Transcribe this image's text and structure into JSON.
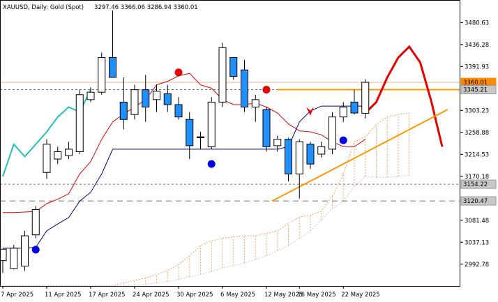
{
  "chart_data": {
    "type": "candlestick",
    "title": "XAUUSD, Daily:  Gold (Spot)",
    "ohlc_label": "3297.46 3366.06 3286.94 3360.01",
    "colors": {
      "background": "#ffffff",
      "bull_candle": "#ffffff",
      "bear_candle": "#1e90ff",
      "candle_outline": "#000000",
      "red_line": "#e60000",
      "blue_line": "#00008b",
      "teal_line": "#20c0c0",
      "trend_line": "#ff9900",
      "kumo": "#f4a460",
      "current_price": "#ff8c00",
      "marker_red": "#e60000",
      "marker_blue": "#0000e6"
    },
    "y_axis": {
      "min": 2948.78,
      "max": 3524.78,
      "ticks": [
        "3480.63",
        "3436.28",
        "3391.93",
        "3303.23",
        "3258.88",
        "3214.53",
        "3170.18",
        "3081.48",
        "3037.13",
        "2992.78"
      ],
      "price_labels": [
        {
          "value": 3360.01,
          "text": "3360.01",
          "kind": "current"
        },
        {
          "value": 3345.21,
          "text": "3345.21",
          "kind": "level"
        },
        {
          "value": 3154.22,
          "text": "3154.22",
          "kind": "level"
        },
        {
          "value": 3120.47,
          "text": "3120.47",
          "kind": "level"
        }
      ]
    },
    "x_axis": {
      "ticks": [
        {
          "index": 0,
          "label": "7 Apr 2025"
        },
        {
          "index": 4,
          "label": "11 Apr 2025"
        },
        {
          "index": 8,
          "label": "17 Apr 2025"
        },
        {
          "index": 12,
          "label": "24 Apr 2025"
        },
        {
          "index": 16,
          "label": "30 Apr 2025"
        },
        {
          "index": 20,
          "label": "6 May 2025"
        },
        {
          "index": 24,
          "label": "12 May 2025"
        },
        {
          "index": 27,
          "label": "16 May 2025"
        },
        {
          "index": 31,
          "label": "22 May 2025"
        }
      ]
    },
    "candles": [
      {
        "o": 3000,
        "h": 3005,
        "l": 2975,
        "c": 3023
      },
      {
        "o": 2984,
        "h": 3032,
        "l": 2982,
        "c": 3025
      },
      {
        "o": 2989,
        "h": 3060,
        "l": 2979,
        "c": 3050
      },
      {
        "o": 3052,
        "h": 3110,
        "l": 3045,
        "c": 3103
      },
      {
        "o": 3178,
        "h": 3245,
        "l": 3165,
        "c": 3235
      },
      {
        "o": 3205,
        "h": 3230,
        "l": 3195,
        "c": 3220
      },
      {
        "o": 3212,
        "h": 3240,
        "l": 3205,
        "c": 3225
      },
      {
        "o": 3220,
        "h": 3345,
        "l": 3215,
        "c": 3335
      },
      {
        "o": 3325,
        "h": 3350,
        "l": 3320,
        "c": 3340
      },
      {
        "o": 3340,
        "h": 3420,
        "l": 3335,
        "c": 3410
      },
      {
        "o": 3410,
        "h": 3505,
        "l": 3370,
        "c": 3370
      },
      {
        "o": 3320,
        "h": 3370,
        "l": 3265,
        "c": 3285
      },
      {
        "o": 3295,
        "h": 3355,
        "l": 3285,
        "c": 3345
      },
      {
        "o": 3345,
        "h": 3375,
        "l": 3280,
        "c": 3310
      },
      {
        "o": 3325,
        "h": 3355,
        "l": 3300,
        "c": 3342
      },
      {
        "o": 3337,
        "h": 3355,
        "l": 3300,
        "c": 3315
      },
      {
        "o": 3315,
        "h": 3330,
        "l": 3285,
        "c": 3290
      },
      {
        "o": 3285,
        "h": 3300,
        "l": 3205,
        "c": 3232
      },
      {
        "o": 3250,
        "h": 3260,
        "l": 3225,
        "c": 3248
      },
      {
        "o": 3230,
        "h": 3330,
        "l": 3225,
        "c": 3320
      },
      {
        "o": 3320,
        "h": 3440,
        "l": 3310,
        "c": 3430
      },
      {
        "o": 3410,
        "h": 3410,
        "l": 3365,
        "c": 3372
      },
      {
        "o": 3385,
        "h": 3405,
        "l": 3300,
        "c": 3310
      },
      {
        "o": 3310,
        "h": 3335,
        "l": 3280,
        "c": 3325
      },
      {
        "o": 3305,
        "h": 3310,
        "l": 3220,
        "c": 3230
      },
      {
        "o": 3232,
        "h": 3252,
        "l": 3220,
        "c": 3245
      },
      {
        "o": 3245,
        "h": 3248,
        "l": 3160,
        "c": 3175
      },
      {
        "o": 3175,
        "h": 3245,
        "l": 3125,
        "c": 3240
      },
      {
        "o": 3235,
        "h": 3240,
        "l": 3185,
        "c": 3195
      },
      {
        "o": 3215,
        "h": 3240,
        "l": 3208,
        "c": 3230
      },
      {
        "o": 3225,
        "h": 3300,
        "l": 3215,
        "c": 3290
      },
      {
        "o": 3290,
        "h": 3320,
        "l": 3280,
        "c": 3310
      },
      {
        "o": 3320,
        "h": 3345,
        "l": 3295,
        "c": 3298
      },
      {
        "o": 3297.46,
        "h": 3366.06,
        "l": 3286.94,
        "c": 3360.01
      }
    ],
    "red_line": [
      3097,
      3097,
      3098,
      3099,
      3115,
      3124,
      3135,
      3175,
      3200,
      3245,
      3280,
      3296,
      3310,
      3325,
      3355,
      3362,
      3373,
      3378,
      3355,
      3348,
      3325,
      3315,
      3315,
      3318,
      3310,
      3298,
      3276,
      3262,
      3260,
      3254,
      3240,
      3230,
      3230,
      3245
    ],
    "blue_line": [
      3025,
      3025,
      3025,
      3027,
      3060,
      3074,
      3087,
      3120,
      3138,
      3175,
      3225,
      3225,
      3225,
      3225,
      3225,
      3225,
      3225,
      3225,
      3225,
      3225,
      3225,
      3225,
      3225,
      3225,
      3225,
      3225,
      3230,
      3280,
      3302,
      3312,
      3312,
      3312,
      3312,
      3312
    ],
    "teal_line": {
      "start": 0,
      "values": [
        3170,
        3235,
        3210,
        3235,
        3260,
        3290,
        3310,
        3300,
        3345
      ]
    },
    "forecast_line": [
      3298,
      3320,
      3370,
      3410,
      3432,
      3400,
      3322,
      3230
    ],
    "kumo": [
      [
        2950,
        2950
      ],
      [
        2950,
        2950
      ],
      [
        2950,
        2950
      ],
      [
        2950,
        2950
      ],
      [
        2950,
        2950
      ],
      [
        2950,
        2950
      ],
      [
        2950,
        2950
      ],
      [
        2950,
        2950
      ],
      [
        2950,
        2950
      ],
      [
        2950,
        2950
      ],
      [
        2950,
        2950
      ],
      [
        2950,
        2955
      ],
      [
        2950,
        2960
      ],
      [
        2952,
        2965
      ],
      [
        2955,
        2972
      ],
      [
        2958,
        2980
      ],
      [
        2962,
        2992
      ],
      [
        2968,
        3010
      ],
      [
        2972,
        3030
      ],
      [
        2978,
        3040
      ],
      [
        2985,
        3045
      ],
      [
        2990,
        3048
      ],
      [
        2995,
        3050
      ],
      [
        3002,
        3050
      ],
      [
        3010,
        3055
      ],
      [
        3020,
        3060
      ],
      [
        3030,
        3075
      ],
      [
        3045,
        3088
      ],
      [
        3060,
        3092
      ],
      [
        3082,
        3100
      ],
      [
        3105,
        3130
      ],
      [
        3120,
        3175
      ],
      [
        3150,
        3240
      ],
      [
        3170,
        3250
      ],
      [
        3168,
        3275
      ],
      [
        3168,
        3290
      ],
      [
        3170,
        3295
      ],
      [
        3172,
        3298
      ]
    ],
    "trend_line": {
      "from": [
        24.5,
        3120
      ],
      "to": [
        40.5,
        3305
      ]
    },
    "markers": [
      {
        "index": 3,
        "value": 3022,
        "color": "blue"
      },
      {
        "index": 16,
        "value": 3380,
        "color": "red"
      },
      {
        "index": 19,
        "value": 3195,
        "color": "blue"
      },
      {
        "index": 24,
        "value": 3345,
        "color": "red"
      },
      {
        "index": 31,
        "value": 3243,
        "color": "blue"
      }
    ],
    "arrow": {
      "index": 28,
      "value": 3300,
      "color": "red"
    },
    "grid": false
  }
}
